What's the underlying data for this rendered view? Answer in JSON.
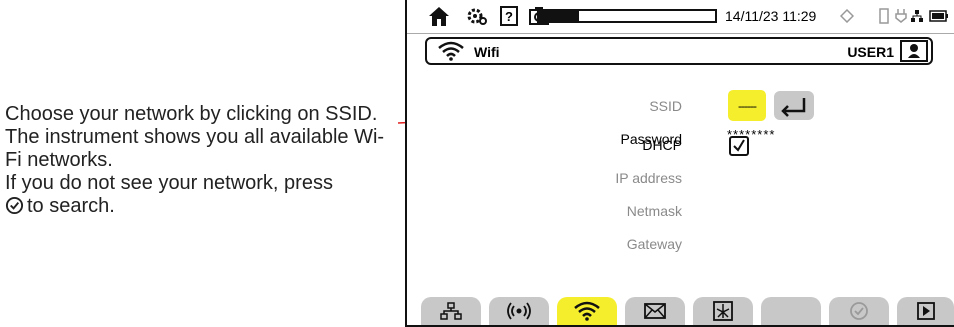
{
  "callout": {
    "line1": "Choose your network by clicking on SSID. The instrument shows you all available Wi-Fi networks.",
    "line2": "If you do not see your network, press",
    "line3": "to search."
  },
  "statusbar": {
    "datetime": "14/11/23 11:29",
    "progress_fraction": 0.23,
    "icons": [
      "home-icon",
      "settings-icon",
      "help-icon",
      "camera-icon",
      "sync-icon",
      "usb-icon",
      "network-icon",
      "battery-icon"
    ]
  },
  "titlebar": {
    "title": "Wifi",
    "user": "USER1"
  },
  "form": {
    "ssid_label": "SSID",
    "ssid_value": "------",
    "password_label": "Password",
    "password_value": "********",
    "dhcp_label": "DHCP",
    "dhcp_checked": true,
    "ip_label": "IP address",
    "netmask_label": "Netmask",
    "gateway_label": "Gateway"
  },
  "tabs": [
    "ethernet-icon",
    "radio-icon",
    "wifi-icon",
    "mail-icon",
    "transfer-icon",
    "blank-tab",
    "search-icon",
    "next-icon"
  ],
  "colors": {
    "highlight": "#f5ee2d",
    "tab": "#c8c8c8",
    "callout_line": "#e02020"
  }
}
